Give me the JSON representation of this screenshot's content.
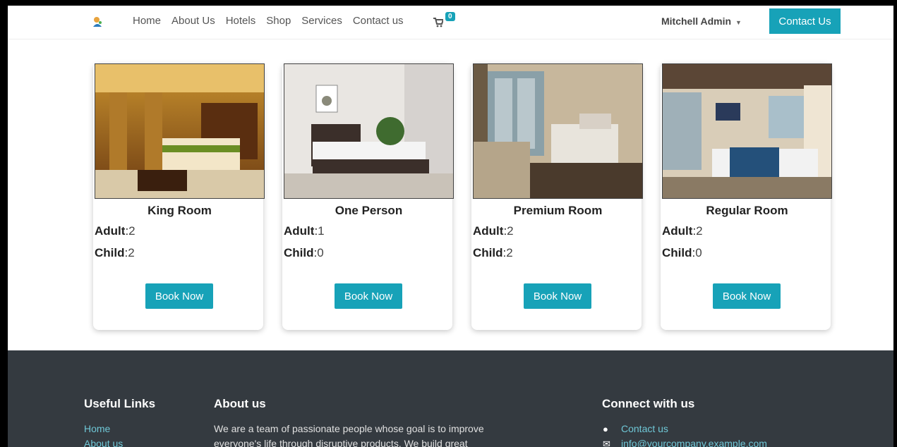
{
  "nav": {
    "links": [
      "Home",
      "About Us",
      "Hotels",
      "Shop",
      "Services",
      "Contact us"
    ],
    "cart_count": "0",
    "user_name": "Mitchell Admin",
    "contact_button": "Contact Us"
  },
  "rooms": [
    {
      "name": "King Room",
      "adult_label": "Adult",
      "adult": "2",
      "child_label": "Child",
      "child": "2",
      "button": "Book Now"
    },
    {
      "name": "One Person",
      "adult_label": "Adult",
      "adult": "1",
      "child_label": "Child",
      "child": "0",
      "button": "Book Now"
    },
    {
      "name": "Premium Room",
      "adult_label": "Adult",
      "adult": "2",
      "child_label": "Child",
      "child": "2",
      "button": "Book Now"
    },
    {
      "name": "Regular Room",
      "adult_label": "Adult",
      "adult": "2",
      "child_label": "Child",
      "child": "0",
      "button": "Book Now"
    }
  ],
  "footer": {
    "useful_links_title": "Useful Links",
    "useful_links": [
      "Home",
      "About us"
    ],
    "about_title": "About us",
    "about_text_1": "We are a team of passionate people whose goal is to improve",
    "about_text_2": "everyone's life through disruptive products. We build great",
    "connect_title": "Connect with us",
    "connect_contact": "Contact us",
    "connect_email": "info@yourcompany.example.com"
  },
  "colors": {
    "accent": "#17a2b8",
    "footer_bg": "#343a40",
    "link": "#6fc7d6"
  }
}
